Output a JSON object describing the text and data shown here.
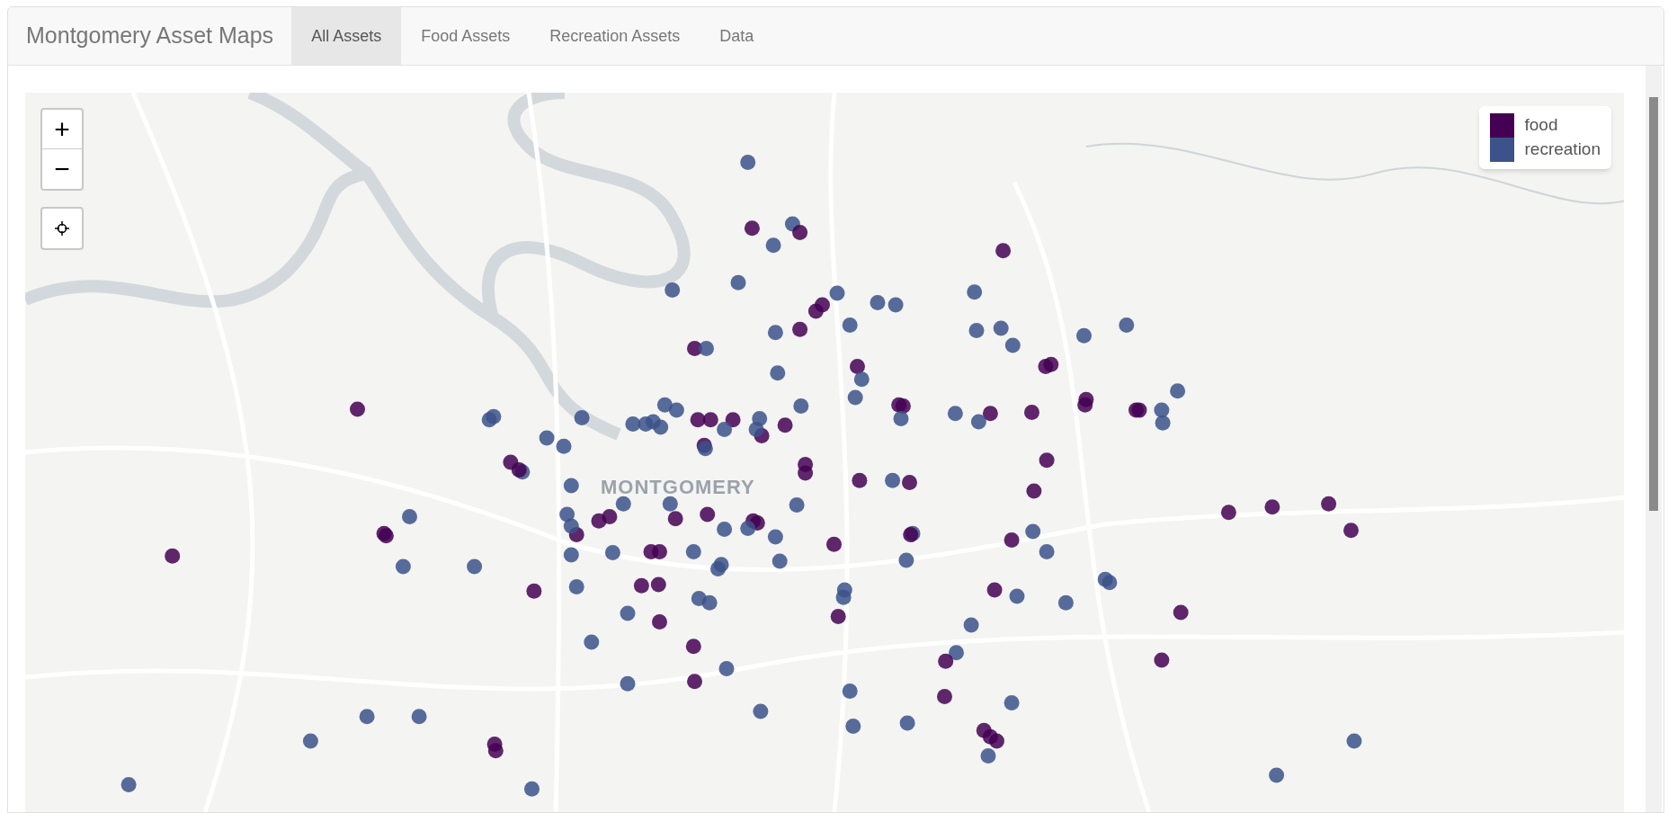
{
  "navbar": {
    "brand": "Montgomery Asset Maps",
    "tabs": [
      {
        "label": "All Assets",
        "selected": true
      },
      {
        "label": "Food Assets",
        "selected": false
      },
      {
        "label": "Recreation Assets",
        "selected": false
      },
      {
        "label": "Data",
        "selected": false
      }
    ]
  },
  "map": {
    "zoom_in": "+",
    "zoom_out": "−",
    "place_label": "MONTGOMERY",
    "legend": [
      {
        "label": "food",
        "color": "#440154"
      },
      {
        "label": "recreation",
        "color": "#3b528b"
      }
    ]
  }
}
